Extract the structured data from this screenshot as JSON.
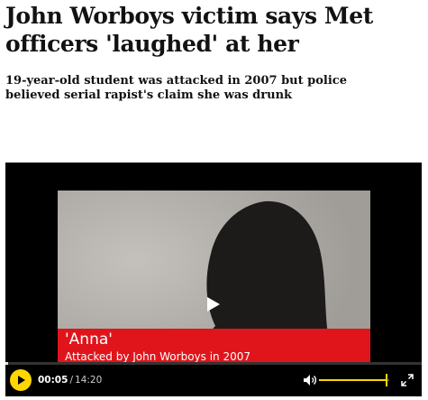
{
  "article": {
    "headline": "John Worboys victim says Met officers 'laughed' at her",
    "standfirst": "19-year-old student was attacked in 2007 but police believed serial rapist's claim she was drunk"
  },
  "video": {
    "caption_name": "'Anna'",
    "caption_description": "Attacked by John Worboys in 2007",
    "current_time": "00:05",
    "separator": "/",
    "duration": "14:20",
    "progress_fraction": 0.006,
    "volume_fraction": 0.95
  },
  "icons": {
    "play_overlay": "play-icon",
    "play_button": "play-icon",
    "volume": "speaker-icon",
    "fullscreen": "fullscreen-icon"
  },
  "colors": {
    "accent_yellow": "#ffd700",
    "caption_red": "#e0151b",
    "player_background": "#000000"
  }
}
